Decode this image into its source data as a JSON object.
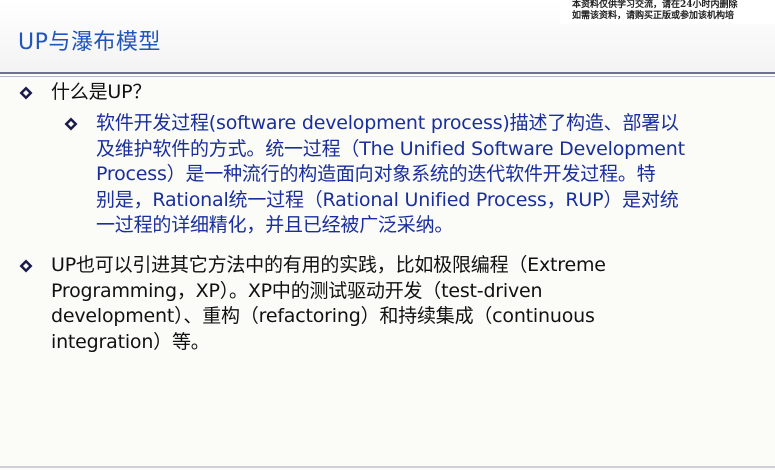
{
  "slide": {
    "title": "UP与瀑布模型",
    "watermark": [
      "本资料仅供学习交流，请在24小时内删除",
      "如需该资料，请购买正版或参加该机构培"
    ],
    "bullets": [
      {
        "icon": "diamond-bullet-icon",
        "lines": [
          "什么是UP？"
        ],
        "sub_bullets": [
          {
            "icon": "diamond-bullet-icon",
            "lines": [
              "软件开发过程(software development process)描述了构造、部署以",
              "及维护软件的方式。统一过程（The Unified Software Development",
              "Process）是一种流行的构造面向对象系统的迭代软件开发过程。特",
              "别是，Rational统一过程（Rational Unified Process，RUP）是对统",
              "一过程的详细精化，并且已经被广泛采纳。"
            ]
          }
        ]
      },
      {
        "icon": "diamond-bullet-icon",
        "lines": [
          "UP也可以引进其它方法中的有用的实践，比如极限编程（Extreme",
          "Programming，XP）。XP中的测试驱动开发（test-driven",
          "development）、重构（refactoring）和持续集成（continuous",
          "integration）等。"
        ]
      }
    ],
    "colors": {
      "title": "#2255bb",
      "sub_text": "#1a2f9c",
      "rule": "#6e6e9a"
    }
  }
}
